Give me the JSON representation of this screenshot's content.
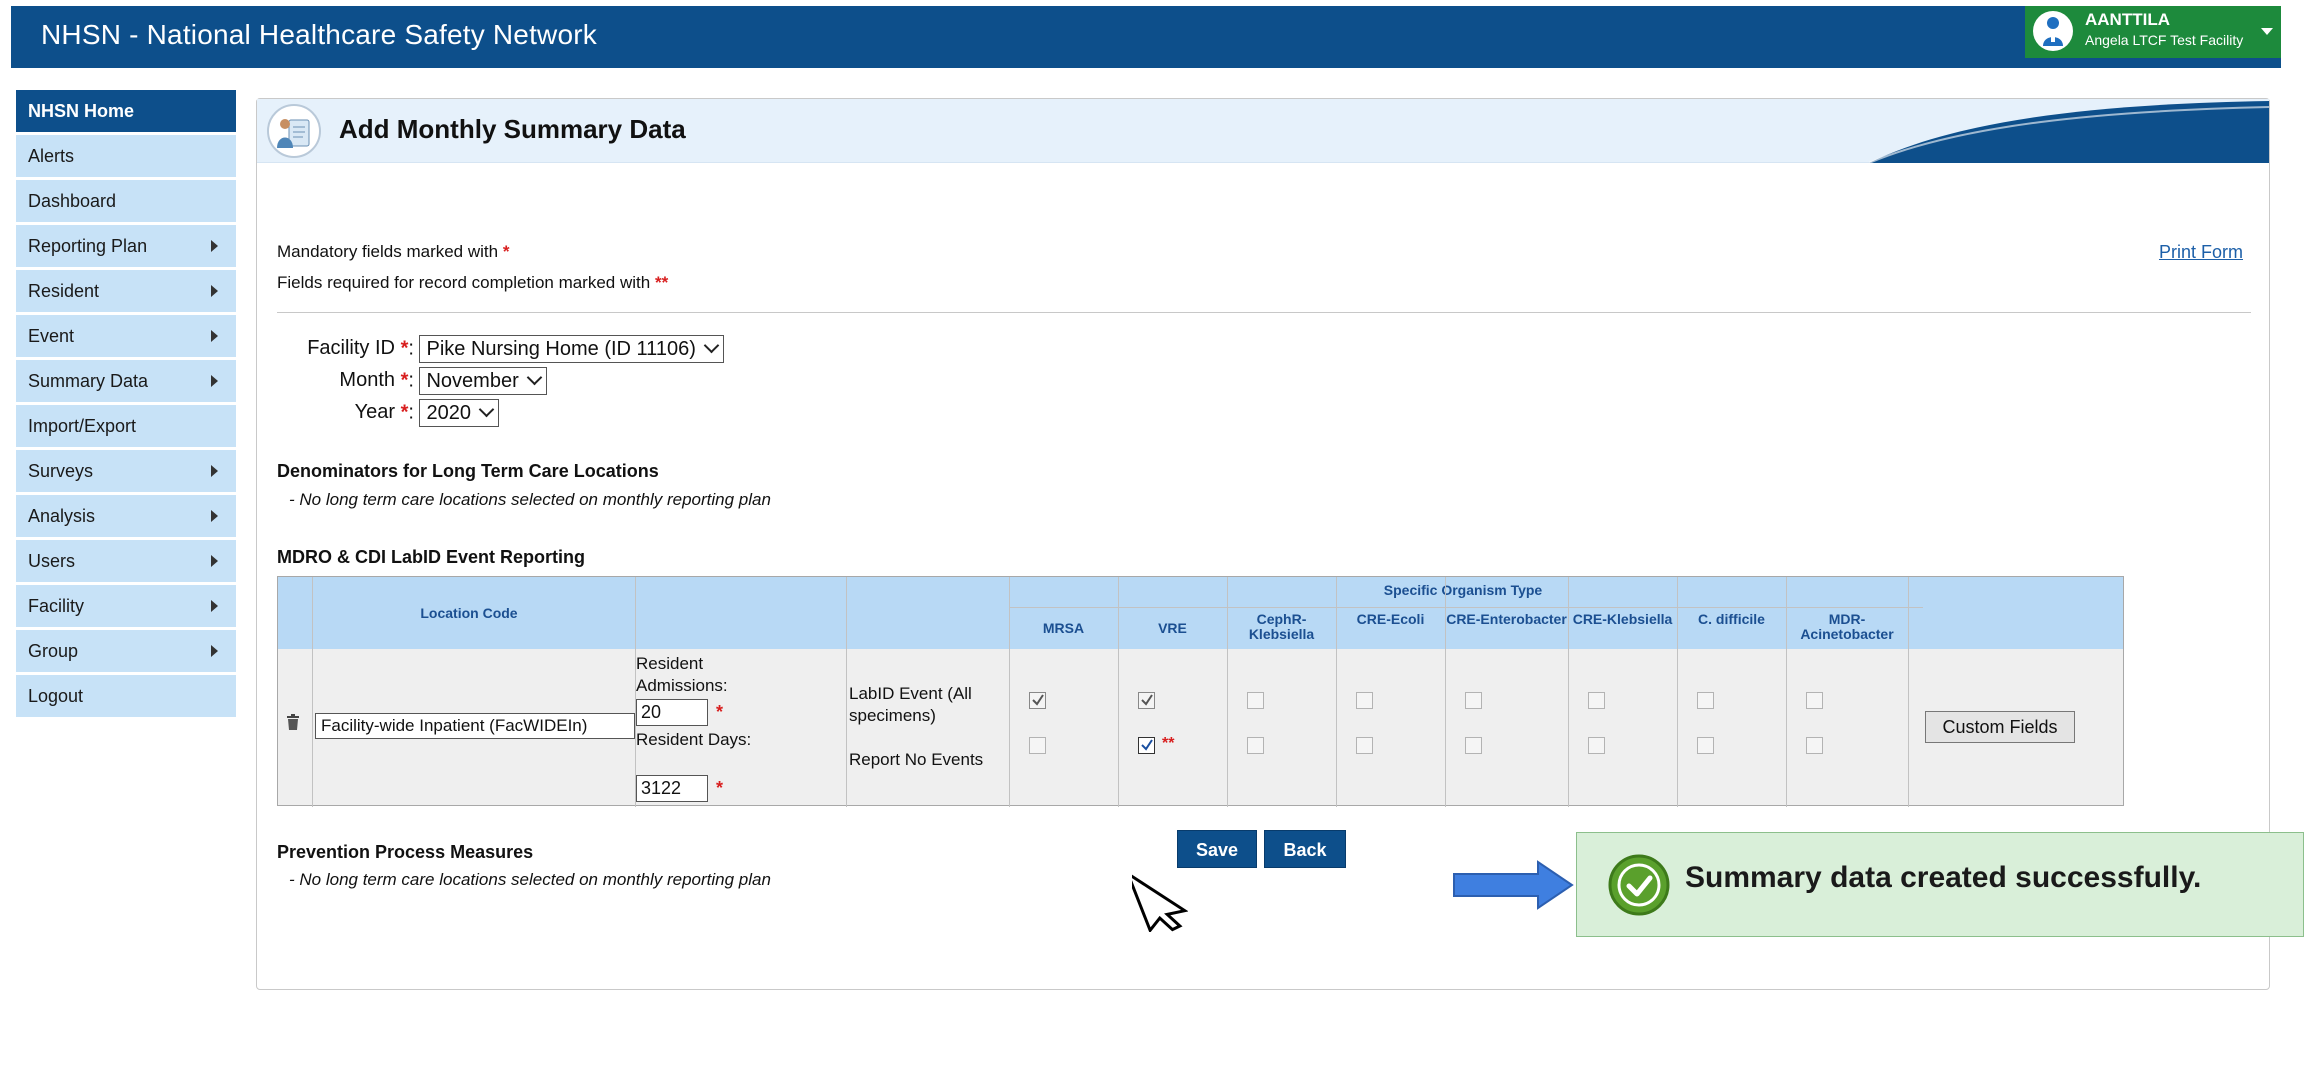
{
  "header": {
    "title": "NHSN - National Healthcare Safety Network",
    "user_name": "AANTTILA",
    "user_facility": "Angela LTCF Test Facility"
  },
  "sidebar": {
    "items": [
      {
        "label": "NHSN Home",
        "has_arrow": false
      },
      {
        "label": "Alerts",
        "has_arrow": false
      },
      {
        "label": "Dashboard",
        "has_arrow": false
      },
      {
        "label": "Reporting Plan",
        "has_arrow": true
      },
      {
        "label": "Resident",
        "has_arrow": true
      },
      {
        "label": "Event",
        "has_arrow": true
      },
      {
        "label": "Summary Data",
        "has_arrow": true
      },
      {
        "label": "Import/Export",
        "has_arrow": false
      },
      {
        "label": "Surveys",
        "has_arrow": true
      },
      {
        "label": "Analysis",
        "has_arrow": true
      },
      {
        "label": "Users",
        "has_arrow": true
      },
      {
        "label": "Facility",
        "has_arrow": true
      },
      {
        "label": "Group",
        "has_arrow": true
      },
      {
        "label": "Logout",
        "has_arrow": false
      }
    ]
  },
  "page": {
    "title": "Add Monthly Summary Data",
    "mandatory_text": "Mandatory fields marked with",
    "mandatory_star": "*",
    "required_text": "Fields required for record completion marked with",
    "required_star": "**",
    "print_form": "Print Form"
  },
  "form": {
    "facility_label": "Facility ID",
    "facility_value": "Pike Nursing Home (ID 11106)",
    "month_label": "Month",
    "month_value": "November",
    "year_label": "Year",
    "year_value": "2020",
    "star": "*",
    "colon": ":"
  },
  "denominators": {
    "title": "Denominators for Long Term Care Locations",
    "note": "- No long term care locations selected on monthly reporting plan"
  },
  "mdro": {
    "title": "MDRO & CDI LabID Event Reporting",
    "location_code_header": "Location Code",
    "specific_organism_header": "Specific Organism Type",
    "organisms": [
      "MRSA",
      "VRE",
      "CephR-Klebsiella",
      "CRE-Ecoli",
      "CRE-Enterobacter",
      "CRE-Klebsiella",
      "C. difficile",
      "MDR-Acinetobacter"
    ],
    "location_value": "Facility-wide Inpatient (FacWIDEIn)",
    "resident_admissions_label": "Resident Admissions:",
    "resident_admissions_value": "20",
    "resident_days_label": "Resident Days:",
    "resident_days_value": "3122",
    "labid_label": "LabID Event (All specimens)",
    "no_events_label": "Report No Events",
    "labid_checked": [
      true,
      true,
      false,
      false,
      false,
      false,
      false,
      false
    ],
    "no_events_checked": [
      false,
      true,
      false,
      false,
      false,
      false,
      false,
      false
    ],
    "custom_fields": "Custom Fields",
    "required_mark": "**"
  },
  "prevention": {
    "title": "Prevention Process Measures",
    "note": "- No long term care locations selected on monthly reporting plan"
  },
  "buttons": {
    "save": "Save",
    "back": "Back"
  },
  "toast": {
    "message": "Summary data created successfully."
  },
  "colors": {
    "brand_blue": "#0d4f8b",
    "nav_light": "#c7e2f7",
    "user_green": "#1d8a3c",
    "required_red": "#d81e1e",
    "toast_green": "#d9efd9"
  }
}
